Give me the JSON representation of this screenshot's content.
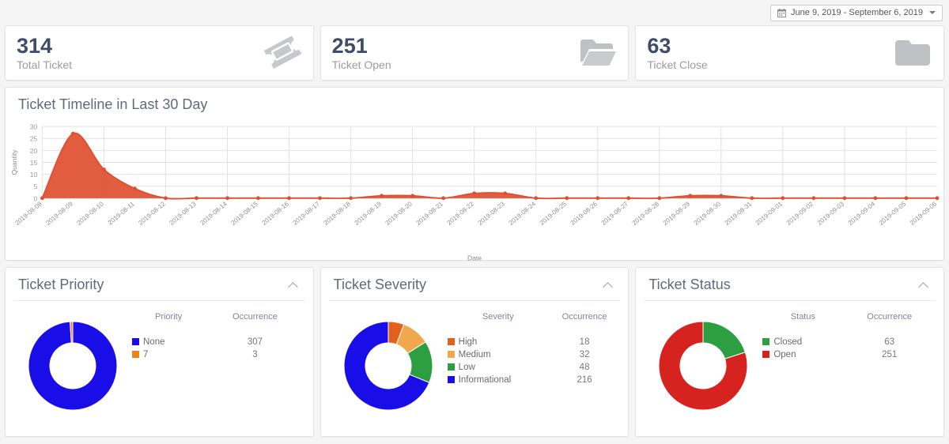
{
  "topbar": {
    "date_range_label": "June 9, 2019 - September 6, 2019",
    "calendar_icon": "calendar-icon",
    "caret_icon": "chevron-down-icon"
  },
  "stats": [
    {
      "value": "314",
      "label": "Total Ticket",
      "icon": "ticket-icon"
    },
    {
      "value": "251",
      "label": "Ticket Open",
      "icon": "folder-open-icon"
    },
    {
      "value": "63",
      "label": "Ticket Close",
      "icon": "folder-closed-icon"
    }
  ],
  "timeline": {
    "title": "Ticket Timeline in Last 30 Day",
    "collapse_icon": "chevron-up-icon"
  },
  "priority": {
    "title": "Ticket Priority",
    "collapse_icon": "chevron-up-icon",
    "col_name": "Priority",
    "col_occurrence": "Occurrence"
  },
  "severity": {
    "title": "Ticket Severity",
    "collapse_icon": "chevron-up-icon",
    "col_name": "Severity",
    "col_occurrence": "Occurrence"
  },
  "status": {
    "title": "Ticket Status",
    "collapse_icon": "chevron-up-icon",
    "col_name": "Status",
    "col_occurrence": "Occurrence"
  },
  "colors": {
    "blue": "#1a0ee8",
    "green": "#2e9e42",
    "orange_light": "#f0a84c",
    "orange_dark": "#e2621b",
    "red": "#d6231f",
    "line_red": "#e04e30",
    "value_text": "#3f4d67",
    "label_text": "#9c9c9c"
  },
  "chart_data": [
    {
      "id": "ticket-timeline",
      "type": "area",
      "title": "Ticket Timeline in Last 30 Day",
      "xlabel": "Date",
      "ylabel": "Quantity",
      "ylim": [
        0,
        30
      ],
      "yticks": [
        0,
        5,
        10,
        15,
        20,
        25,
        30
      ],
      "grid": true,
      "legend": "none",
      "series_color": "#e04e30",
      "categories": [
        "2019-08-08",
        "2019-08-09",
        "2019-08-10",
        "2019-08-11",
        "2019-08-12",
        "2019-08-13",
        "2019-08-14",
        "2019-08-15",
        "2019-08-16",
        "2019-08-17",
        "2019-08-18",
        "2019-08-19",
        "2019-08-20",
        "2019-08-21",
        "2019-08-22",
        "2019-08-23",
        "2019-08-24",
        "2019-08-25",
        "2019-08-26",
        "2019-08-27",
        "2019-08-28",
        "2019-08-29",
        "2019-08-30",
        "2019-08-31",
        "2019-09-01",
        "2019-09-02",
        "2019-09-03",
        "2019-09-04",
        "2019-09-05",
        "2019-09-06"
      ],
      "values": [
        0,
        27,
        12,
        4,
        0,
        0,
        0,
        0,
        0,
        0,
        0,
        1,
        1,
        0,
        2,
        2,
        0,
        0,
        0,
        0,
        0,
        1,
        1,
        0,
        0,
        0,
        0,
        0,
        0,
        0
      ]
    },
    {
      "id": "ticket-priority",
      "type": "pie",
      "title": "Ticket Priority",
      "labels": [
        "None",
        "7"
      ],
      "values": [
        307,
        3
      ],
      "colors": [
        "#1a0ee8",
        "#e8841b"
      ]
    },
    {
      "id": "ticket-severity",
      "type": "pie",
      "title": "Ticket Severity",
      "labels": [
        "High",
        "Medium",
        "Low",
        "Informational"
      ],
      "values": [
        18,
        32,
        48,
        216
      ],
      "colors": [
        "#e2621b",
        "#f0a84c",
        "#2e9e42",
        "#1a0ee8"
      ]
    },
    {
      "id": "ticket-status",
      "type": "pie",
      "title": "Ticket Status",
      "labels": [
        "Closed",
        "Open"
      ],
      "values": [
        63,
        251
      ],
      "colors": [
        "#2e9e42",
        "#d6231f"
      ]
    }
  ]
}
